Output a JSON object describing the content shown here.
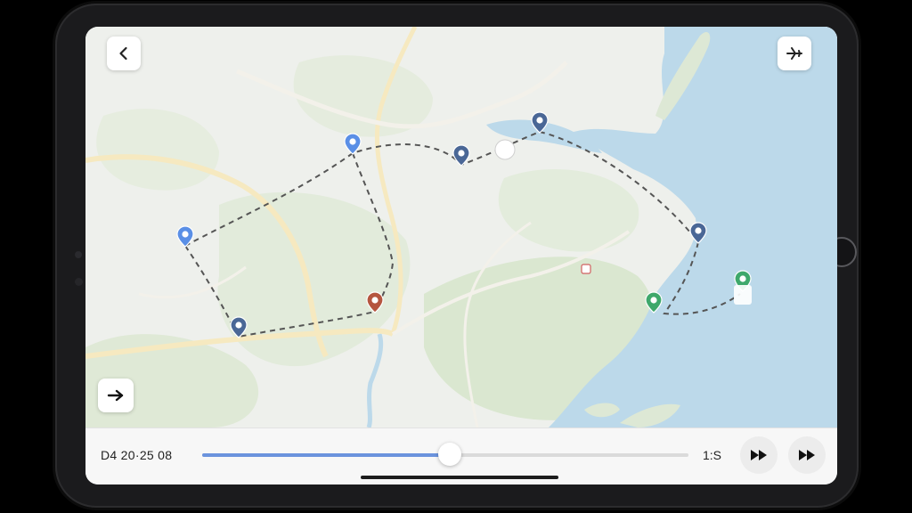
{
  "toolbar": {
    "back_icon": "chevron-left-icon",
    "flight_icon": "airplane-icon",
    "goto_icon": "arrow-right-icon"
  },
  "playback": {
    "time": "D4 20·25 08",
    "speed": "1:S",
    "progress_percent": 51,
    "forward_icon": "fast-forward-icon"
  },
  "route": {
    "stops": [
      {
        "id": "stop-1",
        "color": "#5a8fe6"
      },
      {
        "id": "stop-2",
        "color": "#5a8fe6"
      },
      {
        "id": "stop-3",
        "color": "#4a6796"
      },
      {
        "id": "stop-4",
        "color": "#4a6796"
      },
      {
        "id": "stop-5",
        "color": "#4a6796"
      },
      {
        "id": "stop-6",
        "color": "#b5553f"
      },
      {
        "id": "stop-7",
        "color": "#4a6796"
      },
      {
        "id": "stop-8",
        "color": "#3ea86b"
      },
      {
        "id": "stop-9",
        "color": "#3ea86b"
      }
    ]
  },
  "colors": {
    "land": "#eef0ec",
    "forest": "#dde8d5",
    "water": "#bcd9ea",
    "road": "#f8edc7",
    "route_line": "#555555",
    "accent": "#6b93dd"
  }
}
